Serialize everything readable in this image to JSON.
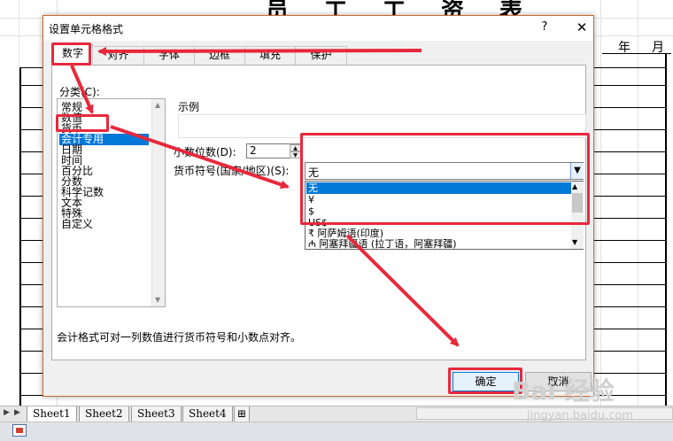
{
  "sheet": {
    "title": "员工工资表",
    "year_label": "年",
    "month_label": "月",
    "tabs": [
      "Sheet1",
      "Sheet2",
      "Sheet3",
      "Sheet4"
    ]
  },
  "dialog": {
    "title": "设置单元格格式",
    "help_symbol": "?",
    "close_symbol": "✕",
    "tabs": [
      "数字",
      "对齐",
      "字体",
      "边框",
      "填充",
      "保护"
    ],
    "active_tab": "数字",
    "category_label": "分类(C):",
    "categories": [
      "常规",
      "数值",
      "货币",
      "会计专用",
      "日期",
      "时间",
      "百分比",
      "分数",
      "科学记数",
      "文本",
      "特殊",
      "自定义"
    ],
    "selected_category": "会计专用",
    "sample_label": "示例",
    "decimal_label": "小数位数(D):",
    "decimal_value": "2",
    "currency_label": "货币符号(国家/地区)(S):",
    "currency_value": "无",
    "currency_options": [
      "无",
      "¥",
      "$",
      "US$",
      "₹ 阿萨姆语(印度)",
      "₼ 阿塞拜疆语 (拉丁语，阿塞拜疆)"
    ],
    "description": "会计格式可对一列数值进行货币符号和小数点对齐。",
    "ok_label": "确定",
    "cancel_label": "取消"
  },
  "watermark": {
    "brand": "Bai 经验",
    "url": "jingyan.baidu.com"
  },
  "colors": {
    "annotation_red": "#e8283c",
    "selection_blue": "#0078d7"
  }
}
